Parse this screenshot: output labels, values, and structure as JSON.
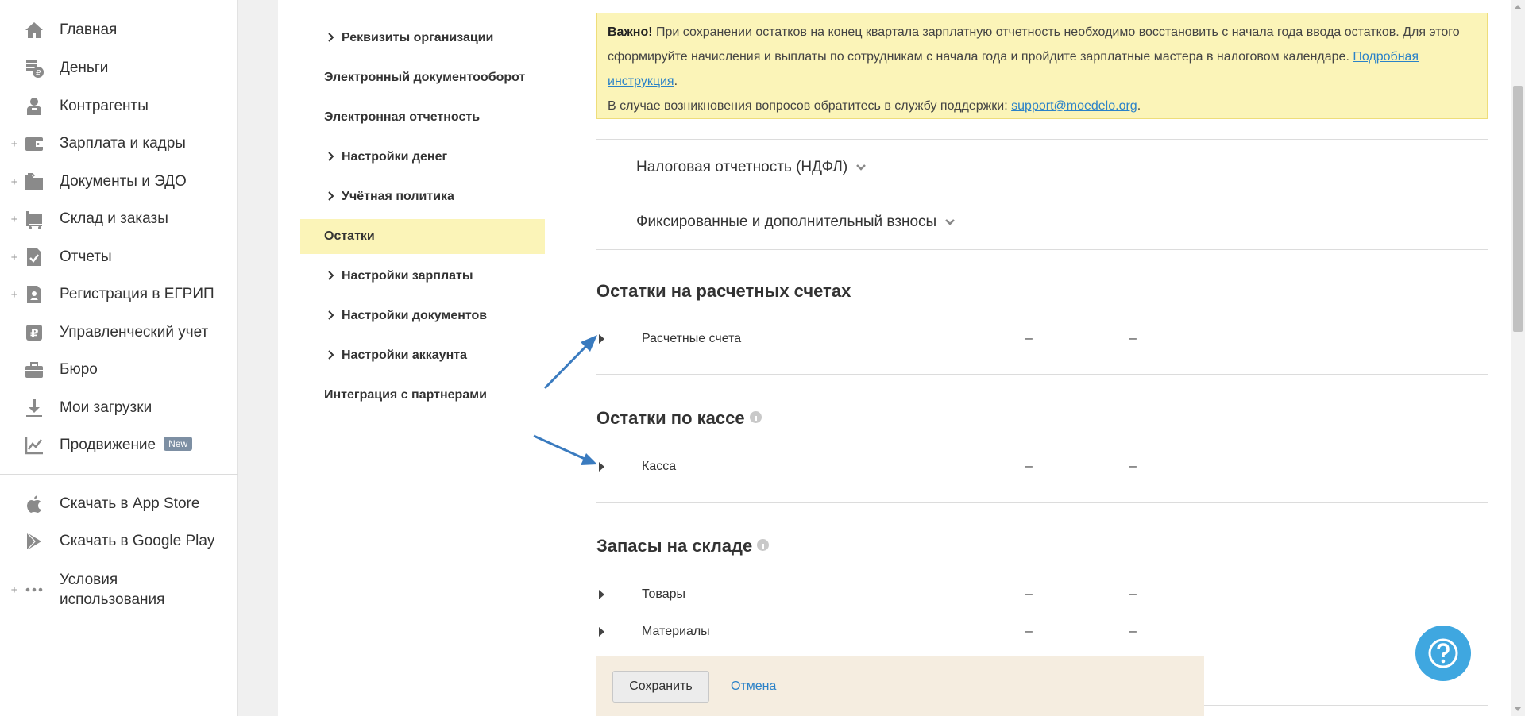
{
  "sidebar": {
    "items": [
      {
        "label": "Главная",
        "icon": "home-icon",
        "plus": ""
      },
      {
        "label": "Деньги",
        "icon": "money-icon",
        "plus": ""
      },
      {
        "label": "Контрагенты",
        "icon": "contractors-icon",
        "plus": ""
      },
      {
        "label": "Зарплата и кадры",
        "icon": "wallet-icon",
        "plus": "+"
      },
      {
        "label": "Документы и ЭДО",
        "icon": "folder-icon",
        "plus": "+"
      },
      {
        "label": "Склад и заказы",
        "icon": "warehouse-icon",
        "plus": "+"
      },
      {
        "label": "Отчеты",
        "icon": "reports-icon",
        "plus": "+"
      },
      {
        "label": "Регистрация в ЕГРИП",
        "icon": "registration-icon",
        "plus": "+"
      },
      {
        "label": "Управленческий учет",
        "icon": "management-icon",
        "plus": ""
      },
      {
        "label": "Бюро",
        "icon": "briefcase-icon",
        "plus": ""
      },
      {
        "label": "Мои загрузки",
        "icon": "download-icon",
        "plus": ""
      },
      {
        "label": "Продвижение",
        "icon": "promotion-icon",
        "plus": "",
        "badge": "New"
      }
    ],
    "bottom_items": [
      {
        "label": "Скачать в App Store",
        "icon": "apple-icon"
      },
      {
        "label": "Скачать в Google Play",
        "icon": "google-play-icon"
      },
      {
        "label": "Условия использования",
        "icon": "more-icon",
        "plus": "+"
      }
    ]
  },
  "settings_menu": {
    "items": [
      {
        "label": "Реквизиты организации",
        "arrow": true
      },
      {
        "label": "Электронный документооборот",
        "arrow": false
      },
      {
        "label": "Электронная отчетность",
        "arrow": false
      },
      {
        "label": "Настройки денег",
        "arrow": true
      },
      {
        "label": "Учётная политика",
        "arrow": true
      },
      {
        "label": "Остатки",
        "arrow": false,
        "active": true
      },
      {
        "label": "Настройки зарплаты",
        "arrow": true
      },
      {
        "label": "Настройки документов",
        "arrow": true
      },
      {
        "label": "Настройки аккаунта",
        "arrow": true
      },
      {
        "label": "Интеграция с партнерами",
        "arrow": false
      }
    ]
  },
  "notice": {
    "important": "Важно!",
    "text1": " При сохранении остатков на конец квартала зарплатную отчетность необходимо восстановить с начала года ввода остатков. Для этого сформируйте начисления и выплаты по сотрудникам с начала года и пройдите зарплатные мастера в налоговом календаре. ",
    "link1": "Подробная инструкция",
    "text1_end": ".",
    "text2": "В случае возникновения вопросов обратитесь в службу поддержки: ",
    "link2": "support@moedelo.org",
    "text2_end": "."
  },
  "accordions": [
    {
      "label": "Налоговая отчетность (НДФЛ)"
    },
    {
      "label": "Фиксированные и дополнительный взносы"
    }
  ],
  "sections": {
    "accounts": {
      "title": "Остатки на расчетных счетах",
      "rows": [
        {
          "label": "Расчетные счета",
          "v1": "–",
          "v2": "–"
        }
      ]
    },
    "cash": {
      "title": "Остатки по кассе",
      "rows": [
        {
          "label": "Касса",
          "v1": "–",
          "v2": "–"
        }
      ]
    },
    "stock": {
      "title": "Запасы на складе",
      "rows": [
        {
          "label": "Товары",
          "v1": "–",
          "v2": "–"
        },
        {
          "label": "Материалы",
          "v1": "–",
          "v2": "–"
        }
      ]
    }
  },
  "actions": {
    "save": "Сохранить",
    "cancel": "Отмена"
  },
  "colors": {
    "accent": "#2b82c8",
    "notice_bg": "#fbf4b8",
    "active_menu": "#fbf4b8",
    "help_button": "#3fa7e0",
    "annotation_arrow": "#3a7bbf"
  }
}
